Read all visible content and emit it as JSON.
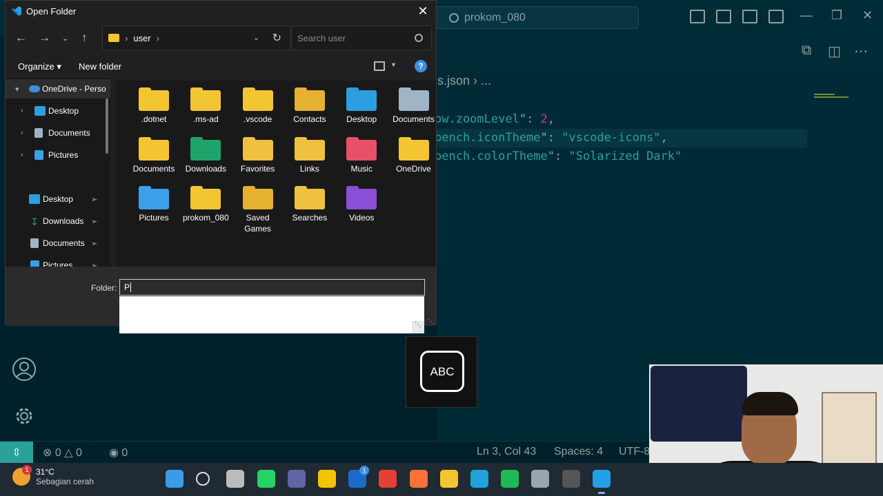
{
  "vscode": {
    "command_center": "prokom_080",
    "breadcrumb": "s.json  ›  ...",
    "code_lines": [
      {
        "key": "ow.zoomLevel",
        "value": "2"
      },
      {
        "key": "bench.iconTheme",
        "value": "\"vscode-icons\""
      },
      {
        "key": "bench.colorTheme",
        "value": "\"Solarized Dark\""
      }
    ],
    "status": {
      "errors": "0",
      "warnings": "0",
      "ports": "0",
      "position": "Ln 3, Col 43",
      "spaces": "Spaces: 4",
      "encoding": "UTF-8"
    }
  },
  "dialog": {
    "title": "Open Folder",
    "address": [
      "user"
    ],
    "search_placeholder": "Search user",
    "commands": {
      "organize": "Organize",
      "new_folder": "New folder"
    },
    "help": "?",
    "nav_items": [
      {
        "label": "OneDrive - Perso",
        "icon": "onedrive-icon",
        "chevron": "expanded"
      },
      {
        "label": "Desktop",
        "icon": "desktop-icon",
        "chevron": "collapsed"
      },
      {
        "label": "Documents",
        "icon": "documents-icon",
        "chevron": "collapsed"
      },
      {
        "label": "Pictures",
        "icon": "pictures-icon",
        "chevron": "collapsed"
      }
    ],
    "quick_access": [
      {
        "label": "Desktop",
        "icon": "desktop-icon"
      },
      {
        "label": "Downloads",
        "icon": "downloads-icon"
      },
      {
        "label": "Documents",
        "icon": "documents-icon"
      },
      {
        "label": "Pictures",
        "icon": "pictures-icon"
      }
    ],
    "files": [
      {
        "name": ".dotnet",
        "icon": "folder-icon",
        "color": "#f3c532"
      },
      {
        "name": ".ms-ad",
        "icon": "folder-icon",
        "color": "#f3c532"
      },
      {
        "name": ".vscode",
        "icon": "folder-icon",
        "color": "#f3c532"
      },
      {
        "name": "Contacts",
        "icon": "contacts-folder-icon",
        "color": "#e6b030"
      },
      {
        "name": "Desktop",
        "icon": "desktop-folder-icon",
        "color": "#2b9fe0"
      },
      {
        "name": "Documents",
        "icon": "documents-folder-icon",
        "color": "#a0b4c8"
      },
      {
        "name": "Documents",
        "icon": "folder-icon",
        "color": "#f3c532"
      },
      {
        "name": "Downloads",
        "icon": "downloads-folder-icon",
        "color": "#1fa36b"
      },
      {
        "name": "Favorites",
        "icon": "favorites-folder-icon",
        "color": "#f0c040"
      },
      {
        "name": "Links",
        "icon": "links-folder-icon",
        "color": "#f0c040"
      },
      {
        "name": "Music",
        "icon": "music-folder-icon",
        "color": "#e8506a"
      },
      {
        "name": "OneDrive",
        "icon": "folder-icon",
        "color": "#f3c532"
      },
      {
        "name": "Pictures",
        "icon": "pictures-folder-icon",
        "color": "#3aa0e8"
      },
      {
        "name": "prokom_080",
        "icon": "folder-icon",
        "color": "#f3c532"
      },
      {
        "name": "Saved Games",
        "icon": "saved-games-folder-icon",
        "color": "#e6b030"
      },
      {
        "name": "Searches",
        "icon": "searches-folder-icon",
        "color": "#f0c040"
      },
      {
        "name": "Videos",
        "icon": "videos-folder-icon",
        "color": "#8b4fd8"
      }
    ],
    "folder_label": "Folder:",
    "folder_value": "P"
  },
  "keyboard_popup": {
    "label": "ABC"
  },
  "taskbar": {
    "weather_temp": "31°C",
    "weather_desc": "Sebagian cerah",
    "weather_badge": "1",
    "apps": [
      {
        "name": "start-button",
        "color": "#3a9be8"
      },
      {
        "name": "search-icon",
        "color": "none"
      },
      {
        "name": "task-view-icon",
        "color": "#bbbbbb"
      },
      {
        "name": "whatsapp-icon",
        "color": "#25d366"
      },
      {
        "name": "teams-icon",
        "color": "#6264a7"
      },
      {
        "name": "store-icon",
        "color": "#f5c400"
      },
      {
        "name": "lync-icon",
        "color": "#1b6ac9"
      },
      {
        "name": "chrome-icon",
        "color": "#e34133"
      },
      {
        "name": "firefox-icon",
        "color": "#ff7139"
      },
      {
        "name": "file-explorer-icon",
        "color": "#f3c532"
      },
      {
        "name": "edge-icon",
        "color": "#1fa3d8"
      },
      {
        "name": "spotify-icon",
        "color": "#1db954"
      },
      {
        "name": "settings-icon",
        "color": "#9aa5b0"
      },
      {
        "name": "obs-icon",
        "color": "#555555"
      },
      {
        "name": "vscode-icon",
        "color": "#22a0e6"
      }
    ],
    "lync_badge": "1"
  }
}
